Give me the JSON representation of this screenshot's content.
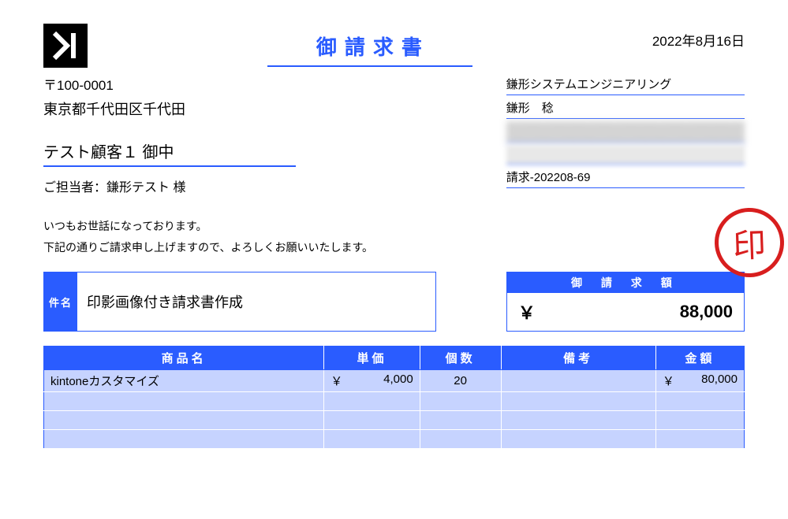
{
  "title": "御請求書",
  "date": "2022年8月16日",
  "sender": {
    "company": "鎌形システムエンジニアリング",
    "name": "鎌形　稔",
    "invoice_no": "請求-202208-69"
  },
  "client": {
    "postal": "〒100-0001",
    "address": "東京都千代田区千代田",
    "name": "テスト顧客１ 御中",
    "contact": "ご担当者：鎌形テスト 様"
  },
  "greeting": {
    "line1": "いつもお世話になっております。",
    "line2": "下記の通りご請求申し上げますので、よろしくお願いいたします。"
  },
  "subject": {
    "label": "件名",
    "value": "印影画像付き請求書作成"
  },
  "total": {
    "label": "御 請 求 額",
    "currency": "￥",
    "value": "88,000"
  },
  "seal_char": "印",
  "columns": {
    "name": "商品名",
    "price": "単価",
    "qty": "個数",
    "note": "備考",
    "amount": "金額"
  },
  "items": [
    {
      "name": "kintoneカスタマイズ",
      "price_cur": "￥",
      "price": "4,000",
      "qty": "20",
      "note": "",
      "amount_cur": "￥",
      "amount": "80,000"
    },
    {
      "name": "",
      "price_cur": "",
      "price": "",
      "qty": "",
      "note": "",
      "amount_cur": "",
      "amount": ""
    },
    {
      "name": "",
      "price_cur": "",
      "price": "",
      "qty": "",
      "note": "",
      "amount_cur": "",
      "amount": ""
    },
    {
      "name": "",
      "price_cur": "",
      "price": "",
      "qty": "",
      "note": "",
      "amount_cur": "",
      "amount": ""
    }
  ]
}
